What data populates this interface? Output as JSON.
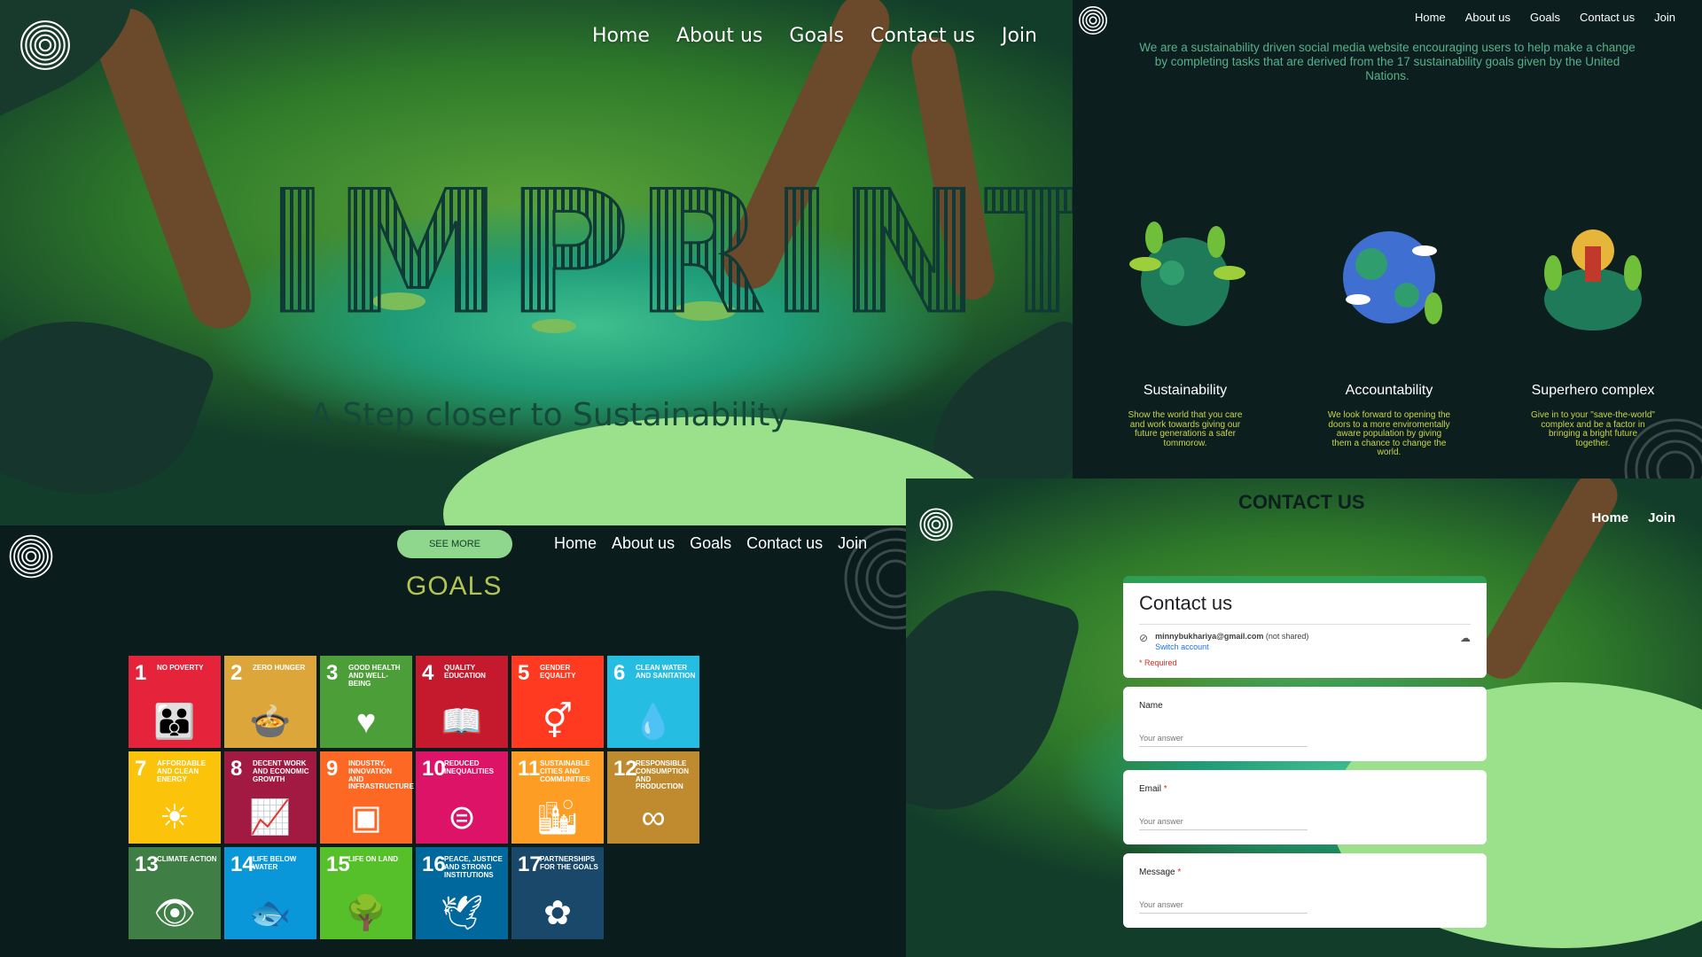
{
  "hero": {
    "nav": [
      "Home",
      "About us",
      "Goals",
      "Contact us",
      "Join"
    ],
    "brand": "IMPRINT",
    "tagline": "A Step closer to Sustainability"
  },
  "about": {
    "nav": [
      "Home",
      "About us",
      "Goals",
      "Contact us",
      "Join"
    ],
    "intro": "We are a sustainability driven social media website encouraging users to help make a change by completing tasks that are derived from the 17 sustainability goals given by the United Nations.",
    "cards": [
      {
        "title": "Sustainability",
        "desc": "Show the world that you care and work towards giving our future generations a safer tommorow."
      },
      {
        "title": "Accountability",
        "desc": "We look forward to opening the doors to a more enviromentally aware population by giving them a chance to change the world."
      },
      {
        "title": "Superhero complex",
        "desc": "Give in to your \"save-the-world\" complex and be a factor in bringing a bright future together."
      }
    ]
  },
  "goals": {
    "see_more": "SEE MORE",
    "nav": [
      "Home",
      "About us",
      "Goals",
      "Contact us",
      "Join"
    ],
    "heading": "GOALS",
    "tiles": [
      {
        "n": "1",
        "t": "No Poverty",
        "c": "#e5243b",
        "i": "👪"
      },
      {
        "n": "2",
        "t": "Zero Hunger",
        "c": "#dda63a",
        "i": "🍲"
      },
      {
        "n": "3",
        "t": "Good Health and Well-Being",
        "c": "#4c9f38",
        "i": "♥"
      },
      {
        "n": "4",
        "t": "Quality Education",
        "c": "#c5192d",
        "i": "📖"
      },
      {
        "n": "5",
        "t": "Gender Equality",
        "c": "#ff3a21",
        "i": "⚥"
      },
      {
        "n": "6",
        "t": "Clean Water and Sanitation",
        "c": "#26bde2",
        "i": "💧"
      },
      {
        "n": "7",
        "t": "Affordable and Clean Energy",
        "c": "#fcc30b",
        "i": "☀"
      },
      {
        "n": "8",
        "t": "Decent Work and Economic Growth",
        "c": "#a21942",
        "i": "📈"
      },
      {
        "n": "9",
        "t": "Industry, Innovation and Infrastructure",
        "c": "#fd6925",
        "i": "▣"
      },
      {
        "n": "10",
        "t": "Reduced Inequalities",
        "c": "#dd1367",
        "i": "⊜"
      },
      {
        "n": "11",
        "t": "Sustainable Cities and Communities",
        "c": "#fd9d24",
        "i": "🏙"
      },
      {
        "n": "12",
        "t": "Responsible Consumption and Production",
        "c": "#bf8b2e",
        "i": "∞"
      },
      {
        "n": "13",
        "t": "Climate Action",
        "c": "#3f7e44",
        "i": "👁"
      },
      {
        "n": "14",
        "t": "Life Below Water",
        "c": "#0a97d9",
        "i": "🐟"
      },
      {
        "n": "15",
        "t": "Life on Land",
        "c": "#56c02b",
        "i": "🌳"
      },
      {
        "n": "16",
        "t": "Peace, Justice and Strong Institutions",
        "c": "#00689d",
        "i": "🕊"
      },
      {
        "n": "17",
        "t": "Partnerships for the Goals",
        "c": "#19486a",
        "i": "✿"
      }
    ]
  },
  "contact": {
    "top_title": "CONTACT US",
    "nav": [
      "Home",
      "Join"
    ],
    "form_title": "Contact us",
    "email": "minnybukhariya@gmail.com",
    "not_shared": "(not shared)",
    "switch_account": "Switch account",
    "required_note": "* Required",
    "fields": [
      {
        "label": "Name",
        "required": false,
        "placeholder": "Your answer"
      },
      {
        "label": "Email",
        "required": true,
        "placeholder": "Your answer"
      },
      {
        "label": "Message",
        "required": true,
        "placeholder": "Your answer"
      }
    ]
  }
}
